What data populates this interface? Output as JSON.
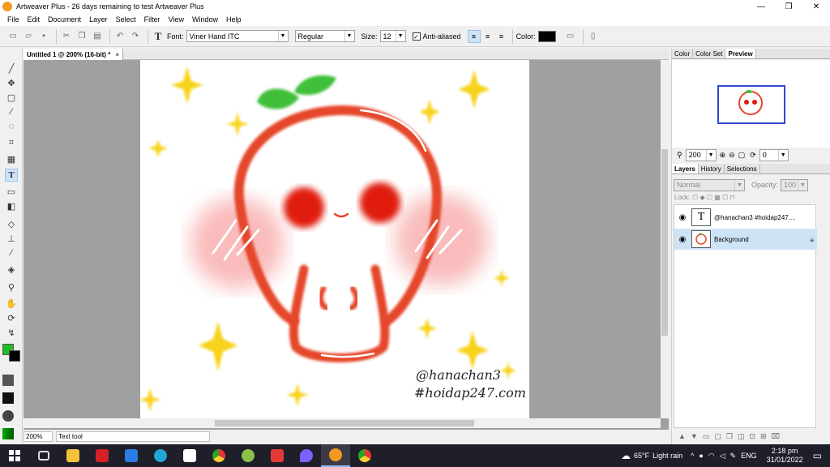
{
  "window": {
    "title": "Artweaver Plus - 26 days remaining to test Artweaver Plus",
    "minimize": "—",
    "maximize": "❐",
    "close": "✕"
  },
  "menu": [
    "File",
    "Edit",
    "Document",
    "Layer",
    "Select",
    "Filter",
    "View",
    "Window",
    "Help"
  ],
  "toolbar": {
    "font_label": "Font:",
    "font_value": "Viner Hand ITC",
    "style_value": "Regular",
    "size_label": "Size:",
    "size_value": "12",
    "antialias_label": "Anti-aliased",
    "color_label": "Color:",
    "color_value": "#000000"
  },
  "document": {
    "tab_title": "Untitled 1 @ 200% (16-bit) *",
    "tab_close": "×",
    "watermark_line1": "@hanachan3",
    "watermark_line2": "#hoidap247.com"
  },
  "status": {
    "zoom": "200%",
    "tool": "Text tool"
  },
  "panels": {
    "top_tabs": [
      "Color",
      "Color Set",
      "Preview"
    ],
    "zoom_value": "200",
    "rotate_value": "0",
    "layer_tabs": [
      "Layers",
      "History",
      "Selections"
    ],
    "blend_mode": "Normal",
    "opacity_label": "Opacity:",
    "opacity_value": "100",
    "lock_label": "Lock:",
    "layers": [
      {
        "name": "@hanachan3 #hoidap247....",
        "thumb": "T"
      },
      {
        "name": "Background",
        "thumb": ""
      }
    ]
  },
  "colors": {
    "foreground": "#20c020",
    "background": "#000000",
    "accent": "#e5472a"
  },
  "taskbar": {
    "weather_temp": "65°F",
    "weather_text": "Light rain",
    "lang": "ENG",
    "time": "2:18 pm",
    "date": "31/01/2022"
  }
}
